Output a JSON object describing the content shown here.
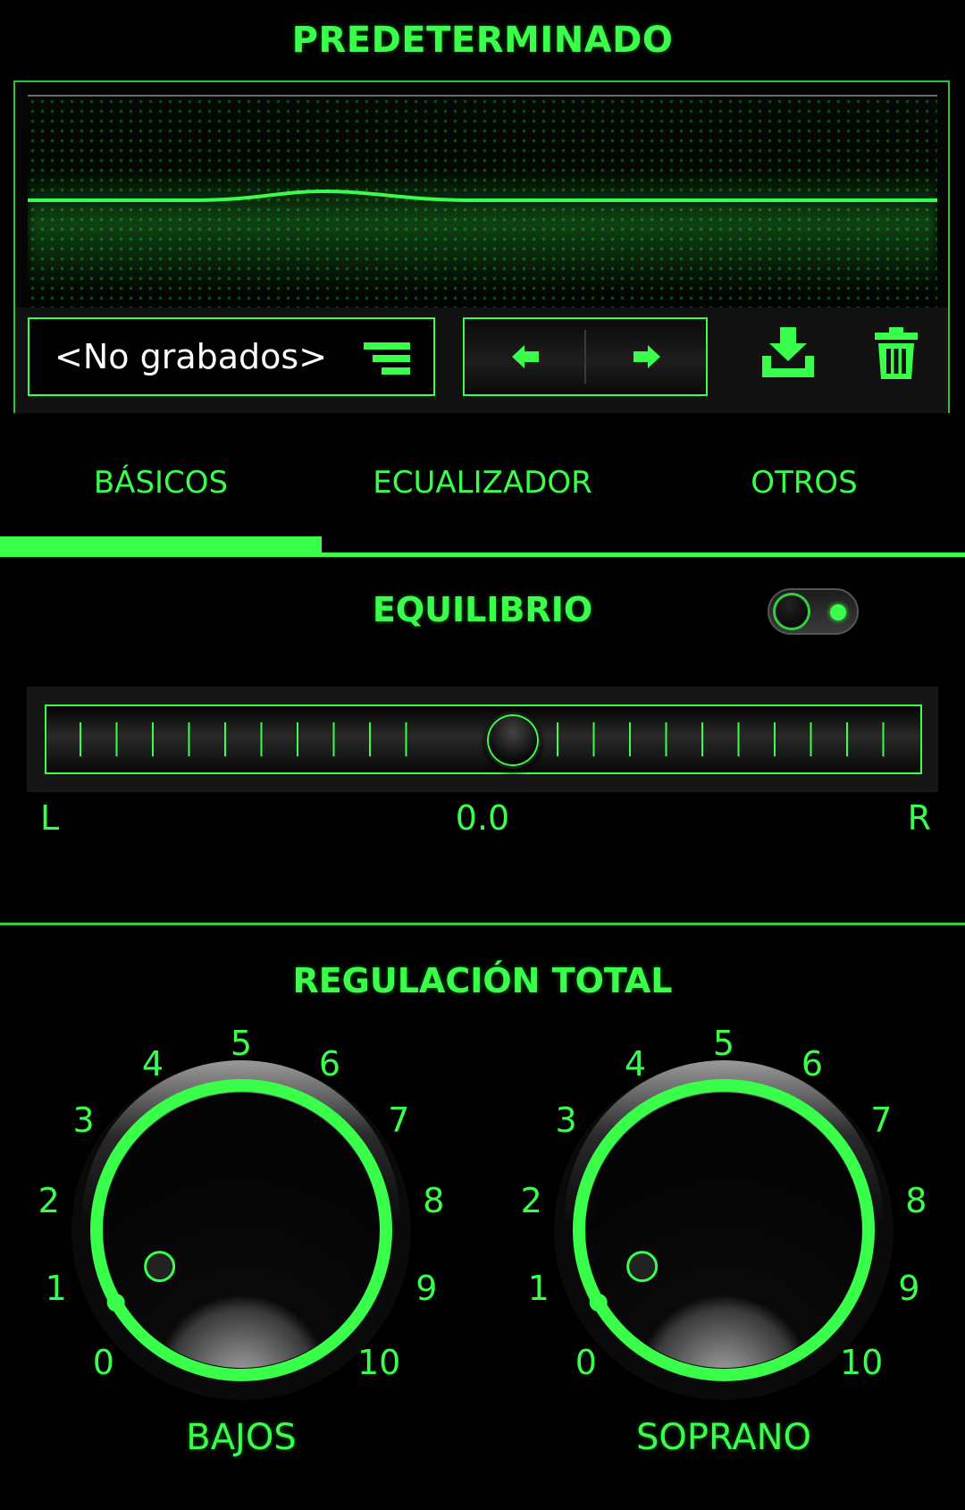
{
  "header": {
    "title": "PREDETERMINADO"
  },
  "preset": {
    "name": "<No grabados>",
    "icons": {
      "list": "list-menu-icon",
      "prev": "arrow-left-icon",
      "next": "arrow-right-icon",
      "save": "download-save-icon",
      "delete": "trash-icon"
    }
  },
  "tabs": [
    {
      "label": "BÁSICOS",
      "active": true
    },
    {
      "label": "ECUALIZADOR"
    },
    {
      "label": "OTROS"
    }
  ],
  "balance": {
    "title": "EQUILIBRIO",
    "enabled": true,
    "value_text": "0.0",
    "left_label": "L",
    "right_label": "R",
    "value": 0.0
  },
  "total": {
    "title": "REGULACIÓN TOTAL",
    "knobs": [
      {
        "label": "BAJOS",
        "value": 1,
        "scale": [
          "0",
          "1",
          "2",
          "3",
          "4",
          "5",
          "6",
          "7",
          "8",
          "9",
          "10"
        ]
      },
      {
        "label": "SOPRANO",
        "value": 1,
        "scale": [
          "0",
          "1",
          "2",
          "3",
          "4",
          "5",
          "6",
          "7",
          "8",
          "9",
          "10"
        ]
      }
    ]
  },
  "colors": {
    "accent": "#39ff4a",
    "background": "#000000",
    "text_light": "#ffffff"
  }
}
